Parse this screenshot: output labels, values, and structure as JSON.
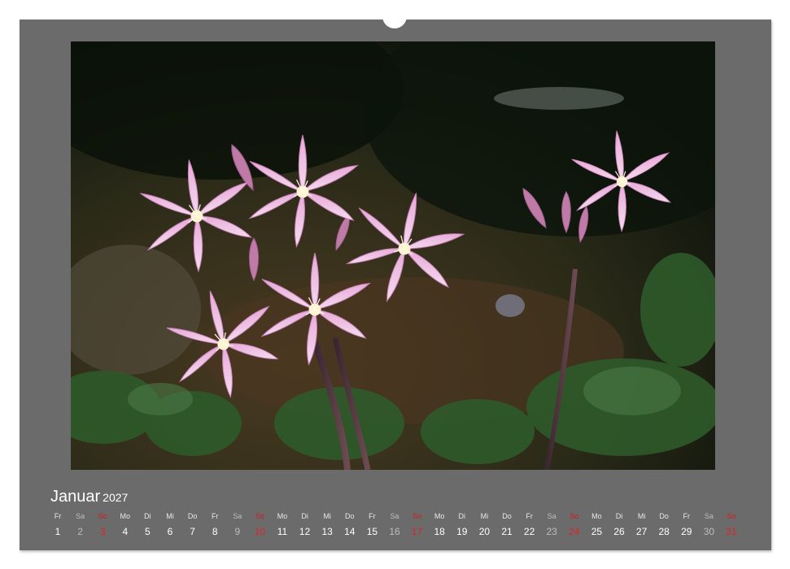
{
  "calendar": {
    "month": "Januar",
    "year": "2027",
    "weekday_labels": [
      "Fr",
      "Sa",
      "So",
      "Mo",
      "Di",
      "Mi",
      "Do",
      "Fr",
      "Sa",
      "So",
      "Mo",
      "Di",
      "Mi",
      "Do",
      "Fr",
      "Sa",
      "So",
      "Mo",
      "Di",
      "Mi",
      "Do",
      "Fr",
      "Sa",
      "So",
      "Mo",
      "Di",
      "Mi",
      "Do",
      "Fr",
      "Sa",
      "So"
    ],
    "day_numbers": [
      "1",
      "2",
      "3",
      "4",
      "5",
      "6",
      "7",
      "8",
      "9",
      "10",
      "11",
      "12",
      "13",
      "14",
      "15",
      "16",
      "17",
      "18",
      "19",
      "20",
      "21",
      "22",
      "23",
      "24",
      "25",
      "26",
      "27",
      "28",
      "29",
      "30",
      "31"
    ],
    "sunday_color": "#e02424",
    "saturday_color": "#bdbdbd",
    "panel_color": "#6b6b6b"
  },
  "photo": {
    "subject_colors": [
      "#e8a9d8",
      "#f4dcef",
      "#b4699c"
    ]
  }
}
